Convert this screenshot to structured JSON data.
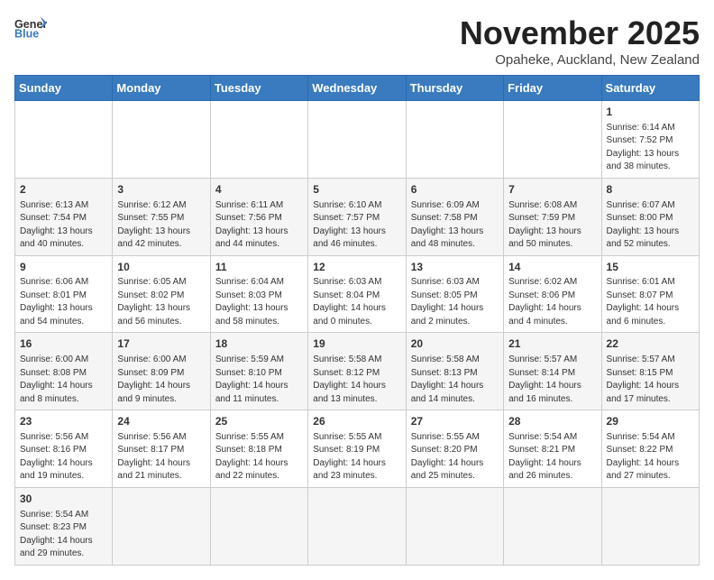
{
  "header": {
    "logo_general": "General",
    "logo_blue": "Blue",
    "month": "November 2025",
    "location": "Opaheke, Auckland, New Zealand"
  },
  "weekdays": [
    "Sunday",
    "Monday",
    "Tuesday",
    "Wednesday",
    "Thursday",
    "Friday",
    "Saturday"
  ],
  "weeks": [
    [
      {
        "day": "",
        "info": ""
      },
      {
        "day": "",
        "info": ""
      },
      {
        "day": "",
        "info": ""
      },
      {
        "day": "",
        "info": ""
      },
      {
        "day": "",
        "info": ""
      },
      {
        "day": "",
        "info": ""
      },
      {
        "day": "1",
        "info": "Sunrise: 6:14 AM\nSunset: 7:52 PM\nDaylight: 13 hours\nand 38 minutes."
      }
    ],
    [
      {
        "day": "2",
        "info": "Sunrise: 6:13 AM\nSunset: 7:54 PM\nDaylight: 13 hours\nand 40 minutes."
      },
      {
        "day": "3",
        "info": "Sunrise: 6:12 AM\nSunset: 7:55 PM\nDaylight: 13 hours\nand 42 minutes."
      },
      {
        "day": "4",
        "info": "Sunrise: 6:11 AM\nSunset: 7:56 PM\nDaylight: 13 hours\nand 44 minutes."
      },
      {
        "day": "5",
        "info": "Sunrise: 6:10 AM\nSunset: 7:57 PM\nDaylight: 13 hours\nand 46 minutes."
      },
      {
        "day": "6",
        "info": "Sunrise: 6:09 AM\nSunset: 7:58 PM\nDaylight: 13 hours\nand 48 minutes."
      },
      {
        "day": "7",
        "info": "Sunrise: 6:08 AM\nSunset: 7:59 PM\nDaylight: 13 hours\nand 50 minutes."
      },
      {
        "day": "8",
        "info": "Sunrise: 6:07 AM\nSunset: 8:00 PM\nDaylight: 13 hours\nand 52 minutes."
      }
    ],
    [
      {
        "day": "9",
        "info": "Sunrise: 6:06 AM\nSunset: 8:01 PM\nDaylight: 13 hours\nand 54 minutes."
      },
      {
        "day": "10",
        "info": "Sunrise: 6:05 AM\nSunset: 8:02 PM\nDaylight: 13 hours\nand 56 minutes."
      },
      {
        "day": "11",
        "info": "Sunrise: 6:04 AM\nSunset: 8:03 PM\nDaylight: 13 hours\nand 58 minutes."
      },
      {
        "day": "12",
        "info": "Sunrise: 6:03 AM\nSunset: 8:04 PM\nDaylight: 14 hours\nand 0 minutes."
      },
      {
        "day": "13",
        "info": "Sunrise: 6:03 AM\nSunset: 8:05 PM\nDaylight: 14 hours\nand 2 minutes."
      },
      {
        "day": "14",
        "info": "Sunrise: 6:02 AM\nSunset: 8:06 PM\nDaylight: 14 hours\nand 4 minutes."
      },
      {
        "day": "15",
        "info": "Sunrise: 6:01 AM\nSunset: 8:07 PM\nDaylight: 14 hours\nand 6 minutes."
      }
    ],
    [
      {
        "day": "16",
        "info": "Sunrise: 6:00 AM\nSunset: 8:08 PM\nDaylight: 14 hours\nand 8 minutes."
      },
      {
        "day": "17",
        "info": "Sunrise: 6:00 AM\nSunset: 8:09 PM\nDaylight: 14 hours\nand 9 minutes."
      },
      {
        "day": "18",
        "info": "Sunrise: 5:59 AM\nSunset: 8:10 PM\nDaylight: 14 hours\nand 11 minutes."
      },
      {
        "day": "19",
        "info": "Sunrise: 5:58 AM\nSunset: 8:12 PM\nDaylight: 14 hours\nand 13 minutes."
      },
      {
        "day": "20",
        "info": "Sunrise: 5:58 AM\nSunset: 8:13 PM\nDaylight: 14 hours\nand 14 minutes."
      },
      {
        "day": "21",
        "info": "Sunrise: 5:57 AM\nSunset: 8:14 PM\nDaylight: 14 hours\nand 16 minutes."
      },
      {
        "day": "22",
        "info": "Sunrise: 5:57 AM\nSunset: 8:15 PM\nDaylight: 14 hours\nand 17 minutes."
      }
    ],
    [
      {
        "day": "23",
        "info": "Sunrise: 5:56 AM\nSunset: 8:16 PM\nDaylight: 14 hours\nand 19 minutes."
      },
      {
        "day": "24",
        "info": "Sunrise: 5:56 AM\nSunset: 8:17 PM\nDaylight: 14 hours\nand 21 minutes."
      },
      {
        "day": "25",
        "info": "Sunrise: 5:55 AM\nSunset: 8:18 PM\nDaylight: 14 hours\nand 22 minutes."
      },
      {
        "day": "26",
        "info": "Sunrise: 5:55 AM\nSunset: 8:19 PM\nDaylight: 14 hours\nand 23 minutes."
      },
      {
        "day": "27",
        "info": "Sunrise: 5:55 AM\nSunset: 8:20 PM\nDaylight: 14 hours\nand 25 minutes."
      },
      {
        "day": "28",
        "info": "Sunrise: 5:54 AM\nSunset: 8:21 PM\nDaylight: 14 hours\nand 26 minutes."
      },
      {
        "day": "29",
        "info": "Sunrise: 5:54 AM\nSunset: 8:22 PM\nDaylight: 14 hours\nand 27 minutes."
      }
    ],
    [
      {
        "day": "30",
        "info": "Sunrise: 5:54 AM\nSunset: 8:23 PM\nDaylight: 14 hours\nand 29 minutes."
      },
      {
        "day": "",
        "info": ""
      },
      {
        "day": "",
        "info": ""
      },
      {
        "day": "",
        "info": ""
      },
      {
        "day": "",
        "info": ""
      },
      {
        "day": "",
        "info": ""
      },
      {
        "day": "",
        "info": ""
      }
    ]
  ]
}
